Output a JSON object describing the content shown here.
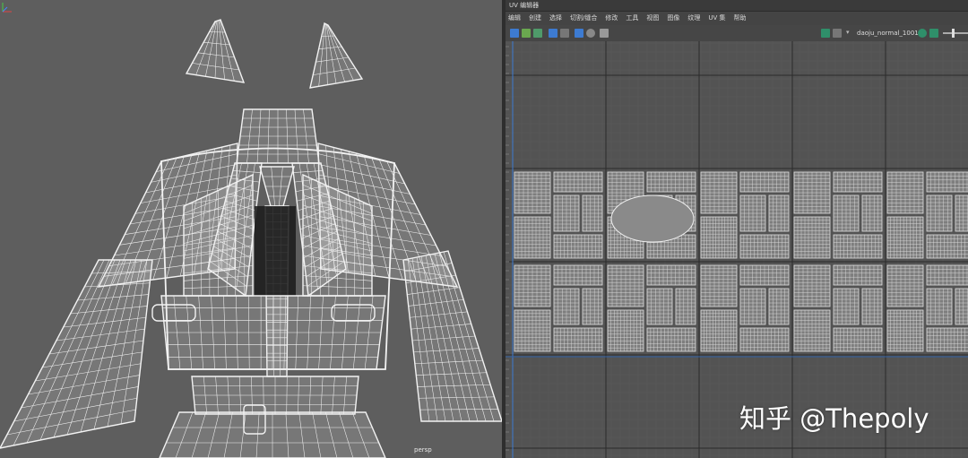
{
  "window": {
    "title": "UV 编辑器"
  },
  "menu": [
    {
      "label": "编辑"
    },
    {
      "label": "创建"
    },
    {
      "label": "选择"
    },
    {
      "label": "切割/缝合"
    },
    {
      "label": "修改"
    },
    {
      "label": "工具"
    },
    {
      "label": "视图"
    },
    {
      "label": "图像"
    },
    {
      "label": "纹理"
    },
    {
      "label": "UV 集"
    },
    {
      "label": "帮助"
    }
  ],
  "toolbar": {
    "texture_name": "daoju_normal_1001"
  },
  "viewport": {
    "camera_label": "persp"
  },
  "watermark": "知乎 @Thepoly",
  "colors": {
    "wire": "#f2f2f2",
    "viewport_bg": "#5e5e5e",
    "uv_bg": "#535353",
    "uv_tile_border": "#2b2b2b",
    "uv_island": "#d9d9d9",
    "accent_blue": "#3d7bd1"
  },
  "icons": [
    "select-tool-icon",
    "move-uv-icon",
    "shading-icon",
    "checker-icon",
    "grid-toggle-icon",
    "image-display-icon",
    "dim-icon",
    "color-channel-icon"
  ]
}
